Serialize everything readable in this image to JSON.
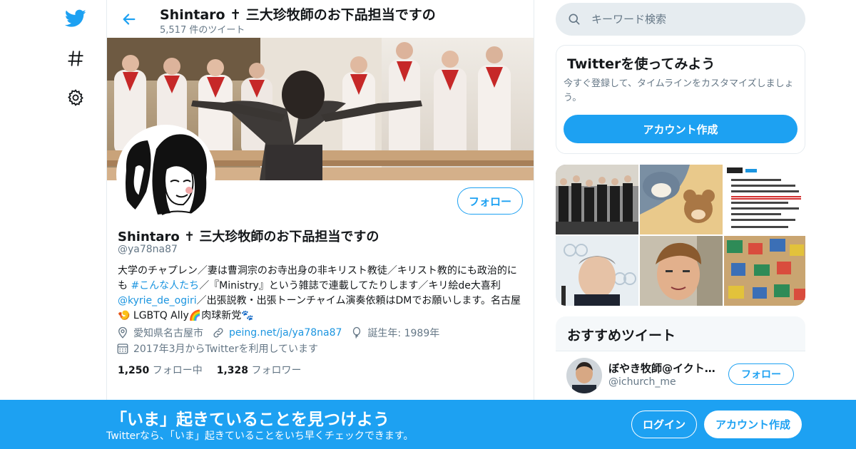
{
  "header": {
    "title": "Shintaro ✝ 三大珍牧師のお下品担当ですの",
    "tweet_count": "5,517 件のツイート"
  },
  "profile": {
    "follow_label": "フォロー",
    "name": "Shintaro ✝ 三大珍牧師のお下品担当ですの",
    "handle": "@ya78na87",
    "bio": {
      "p1": "大学のチャプレン／妻は曹洞宗のお寺出身の非キリスト教徒／キリスト教的にも政治的にも ",
      "hashtag": "#こんな人たち",
      "p2": "／『Ministry』という雑誌で連載してたりします／キリ絵de大喜利 ",
      "mention": "@kyrie_de_ogiri",
      "p3": "／出張説教・出張トーンチャイム演奏依頼はDMでお願いします。名古屋",
      "emoji1": "🍤",
      "p4": " LGBTQ Ally",
      "emoji2": "🌈",
      "p5": "肉球新党",
      "emoji3": "🐾"
    },
    "location": "愛知県名古屋市",
    "website": "peing.net/ja/ya78na87",
    "birthday": "誕生年: 1989年",
    "joined": "2017年3月からTwitterを利用しています",
    "following_count": "1,250",
    "following_label": "フォロー中",
    "followers_count": "1,328",
    "followers_label": "フォロワー"
  },
  "search": {
    "placeholder": "キーワード検索"
  },
  "signup_card": {
    "title": "Twitterを使ってみよう",
    "description": "今すぐ登録して、タイムラインをカスタマイズしましょう。",
    "button": "アカウント作成"
  },
  "recommended": {
    "title": "おすすめツイート",
    "users": [
      {
        "name": "ぼやき牧師@イクト…",
        "handle": "@ichurch_me",
        "follow_label": "フォロー"
      }
    ]
  },
  "bottom_bar": {
    "title": "「いま」起きていることを見つけよう",
    "subtitle": "Twitterなら、「いま」起きていることをいち早くチェックできます。",
    "login": "ログイン",
    "signup": "アカウント作成"
  },
  "icons": [
    "twitter-logo-icon",
    "hashtag-icon",
    "gear-icon",
    "back-arrow-icon",
    "search-icon",
    "location-icon",
    "link-icon",
    "balloon-icon",
    "calendar-icon"
  ],
  "colors": {
    "accent": "#1da1f2",
    "link": "#1b95e0",
    "muted": "#657786",
    "border": "#e6ecf0"
  }
}
